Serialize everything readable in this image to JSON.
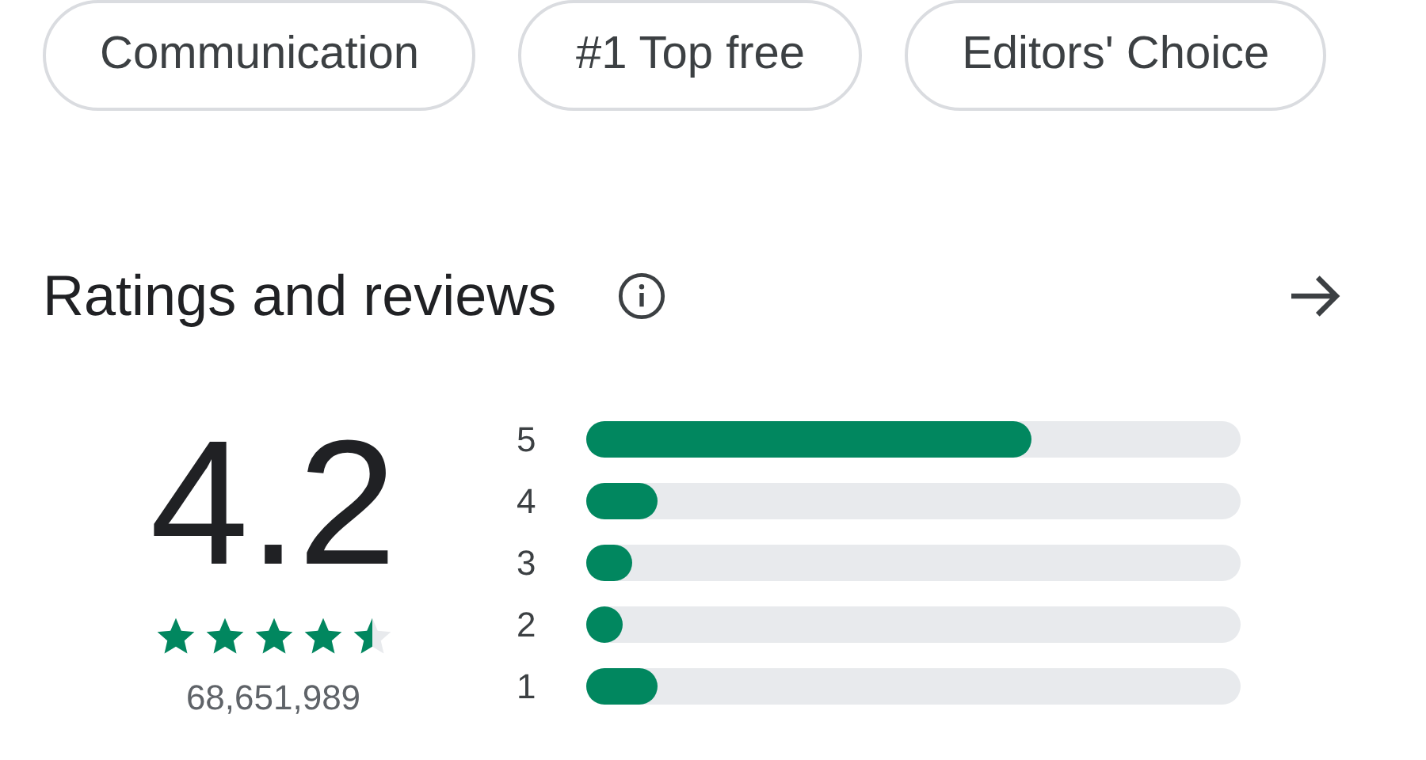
{
  "chips": [
    {
      "label": "Communication"
    },
    {
      "label": "#1 Top free"
    },
    {
      "label": "Editors' Choice"
    }
  ],
  "ratings": {
    "title": "Ratings and reviews",
    "score": "4.2",
    "stars": 4.5,
    "count": "68,651,989",
    "bars": [
      {
        "label": "5",
        "level": 0.68
      },
      {
        "label": "4",
        "level": 0.11
      },
      {
        "label": "3",
        "level": 0.07
      },
      {
        "label": "2",
        "level": 0.055
      },
      {
        "label": "1",
        "level": 0.11
      }
    ]
  }
}
